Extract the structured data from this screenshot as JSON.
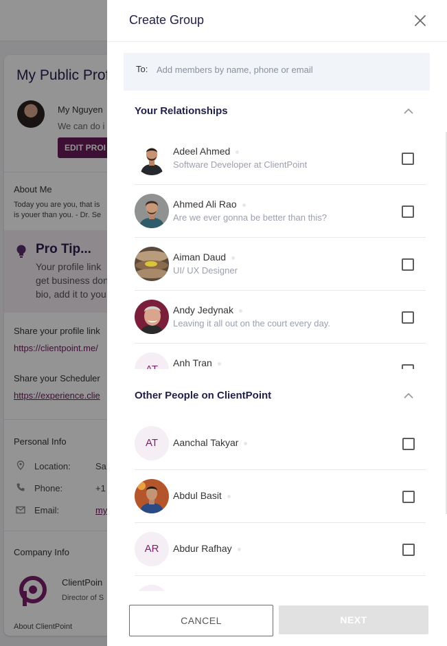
{
  "background_page": {
    "card_title": "My Public Profi",
    "user_name": "My Nguyen",
    "user_quote": "We can do i",
    "edit_button": "EDIT PROI",
    "about_heading": "About Me",
    "about_line1": "Today you are you, that is",
    "about_line2": "is youer than you. - Dr. Se",
    "pro_tip_title": "Pro Tip...",
    "pro_tip_line1": "Your profile link",
    "pro_tip_line2": "get business don",
    "pro_tip_line3": "bio, add it to you",
    "share_profile_label": "Share your profile link",
    "share_profile_link": "https://clientpoint.me/",
    "share_scheduler_label": "Share your Scheduler",
    "share_scheduler_link": "https://experience.clie",
    "personal_info_heading": "Personal Info",
    "location_label": "Location:",
    "location_value": "Sa",
    "phone_label": "Phone:",
    "phone_value": "+1",
    "email_label": "Email:",
    "email_value": "my",
    "company_info_heading": "Company Info",
    "company_name": "ClientPoin",
    "company_role": "Director of S",
    "about_company": "About ClientPoint"
  },
  "drawer": {
    "title": "Create Group",
    "to_label": "To:",
    "to_placeholder": "Add members by name, phone or email",
    "relationships_title": "Your Relationships",
    "others_title": "Other People on ClientPoint",
    "cancel_label": "CANCEL",
    "next_label": "NEXT"
  },
  "relationships": [
    {
      "name": "Adeel Ahmed",
      "subtitle": "Software Developer at ClientPoint",
      "avatar": "photo",
      "initials": ""
    },
    {
      "name": "Ahmed Ali Rao",
      "subtitle": "Are we ever gonna be better than this?",
      "avatar": "photo",
      "initials": ""
    },
    {
      "name": "Aiman Daud",
      "subtitle": "UI/ UX Designer",
      "avatar": "photo",
      "initials": ""
    },
    {
      "name": "Andy Jedynak",
      "subtitle": "Leaving it all out on the court every day.",
      "avatar": "photo",
      "initials": ""
    },
    {
      "name": "Anh Tran",
      "subtitle": "",
      "avatar": "initials",
      "initials": "AT"
    }
  ],
  "others": [
    {
      "name": "Aanchal Takyar",
      "subtitle": "",
      "avatar": "initials",
      "initials": "AT"
    },
    {
      "name": "Abdul Basit",
      "subtitle": "",
      "avatar": "photo",
      "initials": ""
    },
    {
      "name": "Abdur Rafhay",
      "subtitle": "",
      "avatar": "initials",
      "initials": "AR"
    },
    {
      "name": "",
      "subtitle": "",
      "avatar": "initials",
      "initials": ""
    }
  ],
  "colors": {
    "brand_purple": "#6a1b5b",
    "heading_navy": "#1f1f4a",
    "initials_bg": "#f5eef4",
    "initials_text": "#7a1f6a",
    "input_bg": "#f1f4f8",
    "disabled_button": "#e1e1e1"
  },
  "icons": {
    "close": "close-icon",
    "collapse": "chevron-up-icon",
    "checkbox": "checkbox-unchecked-icon",
    "location": "location-pin-icon",
    "phone": "phone-icon",
    "email": "email-icon",
    "tip": "lightbulb-icon"
  }
}
